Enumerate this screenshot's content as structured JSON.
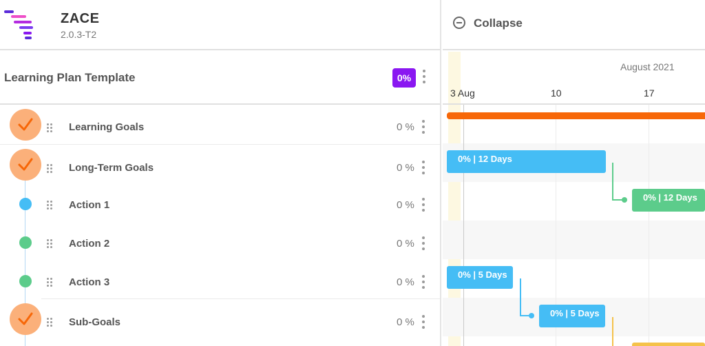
{
  "app": {
    "name": "ZACE",
    "version": "2.0.3-T2"
  },
  "plan": {
    "title": "Learning Plan Template",
    "progress": "0%"
  },
  "rows": [
    {
      "label": "Learning Goals",
      "progress": "0 %",
      "status": "done"
    },
    {
      "label": "Long-Term Goals",
      "progress": "0 %",
      "status": "done"
    },
    {
      "label": "Action 1",
      "progress": "0 %",
      "status": "blue"
    },
    {
      "label": "Action 2",
      "progress": "0 %",
      "status": "green"
    },
    {
      "label": "Action 3",
      "progress": "0 %",
      "status": "green"
    },
    {
      "label": "Sub-Goals",
      "progress": "0 %",
      "status": "done"
    }
  ],
  "gantt": {
    "collapse_label": "Collapse",
    "month": "August 2021",
    "weeks": [
      "3 Aug",
      "10",
      "17"
    ],
    "bars": [
      {
        "label": "0% | 12 Days",
        "color": "#45bdf5"
      },
      {
        "label": "0% | 12 Days",
        "color": "#5ccc8b"
      },
      {
        "label": "0% | 5 Days",
        "color": "#45bdf5"
      },
      {
        "label": "0% | 5 Days",
        "color": "#45bdf5"
      }
    ]
  },
  "colors": {
    "accent": "#8a17f1",
    "summary": "#f76708",
    "done": "#fbb07a",
    "blue": "#45bdf5",
    "green": "#5ccc8b",
    "yellow": "#f5c24a"
  }
}
